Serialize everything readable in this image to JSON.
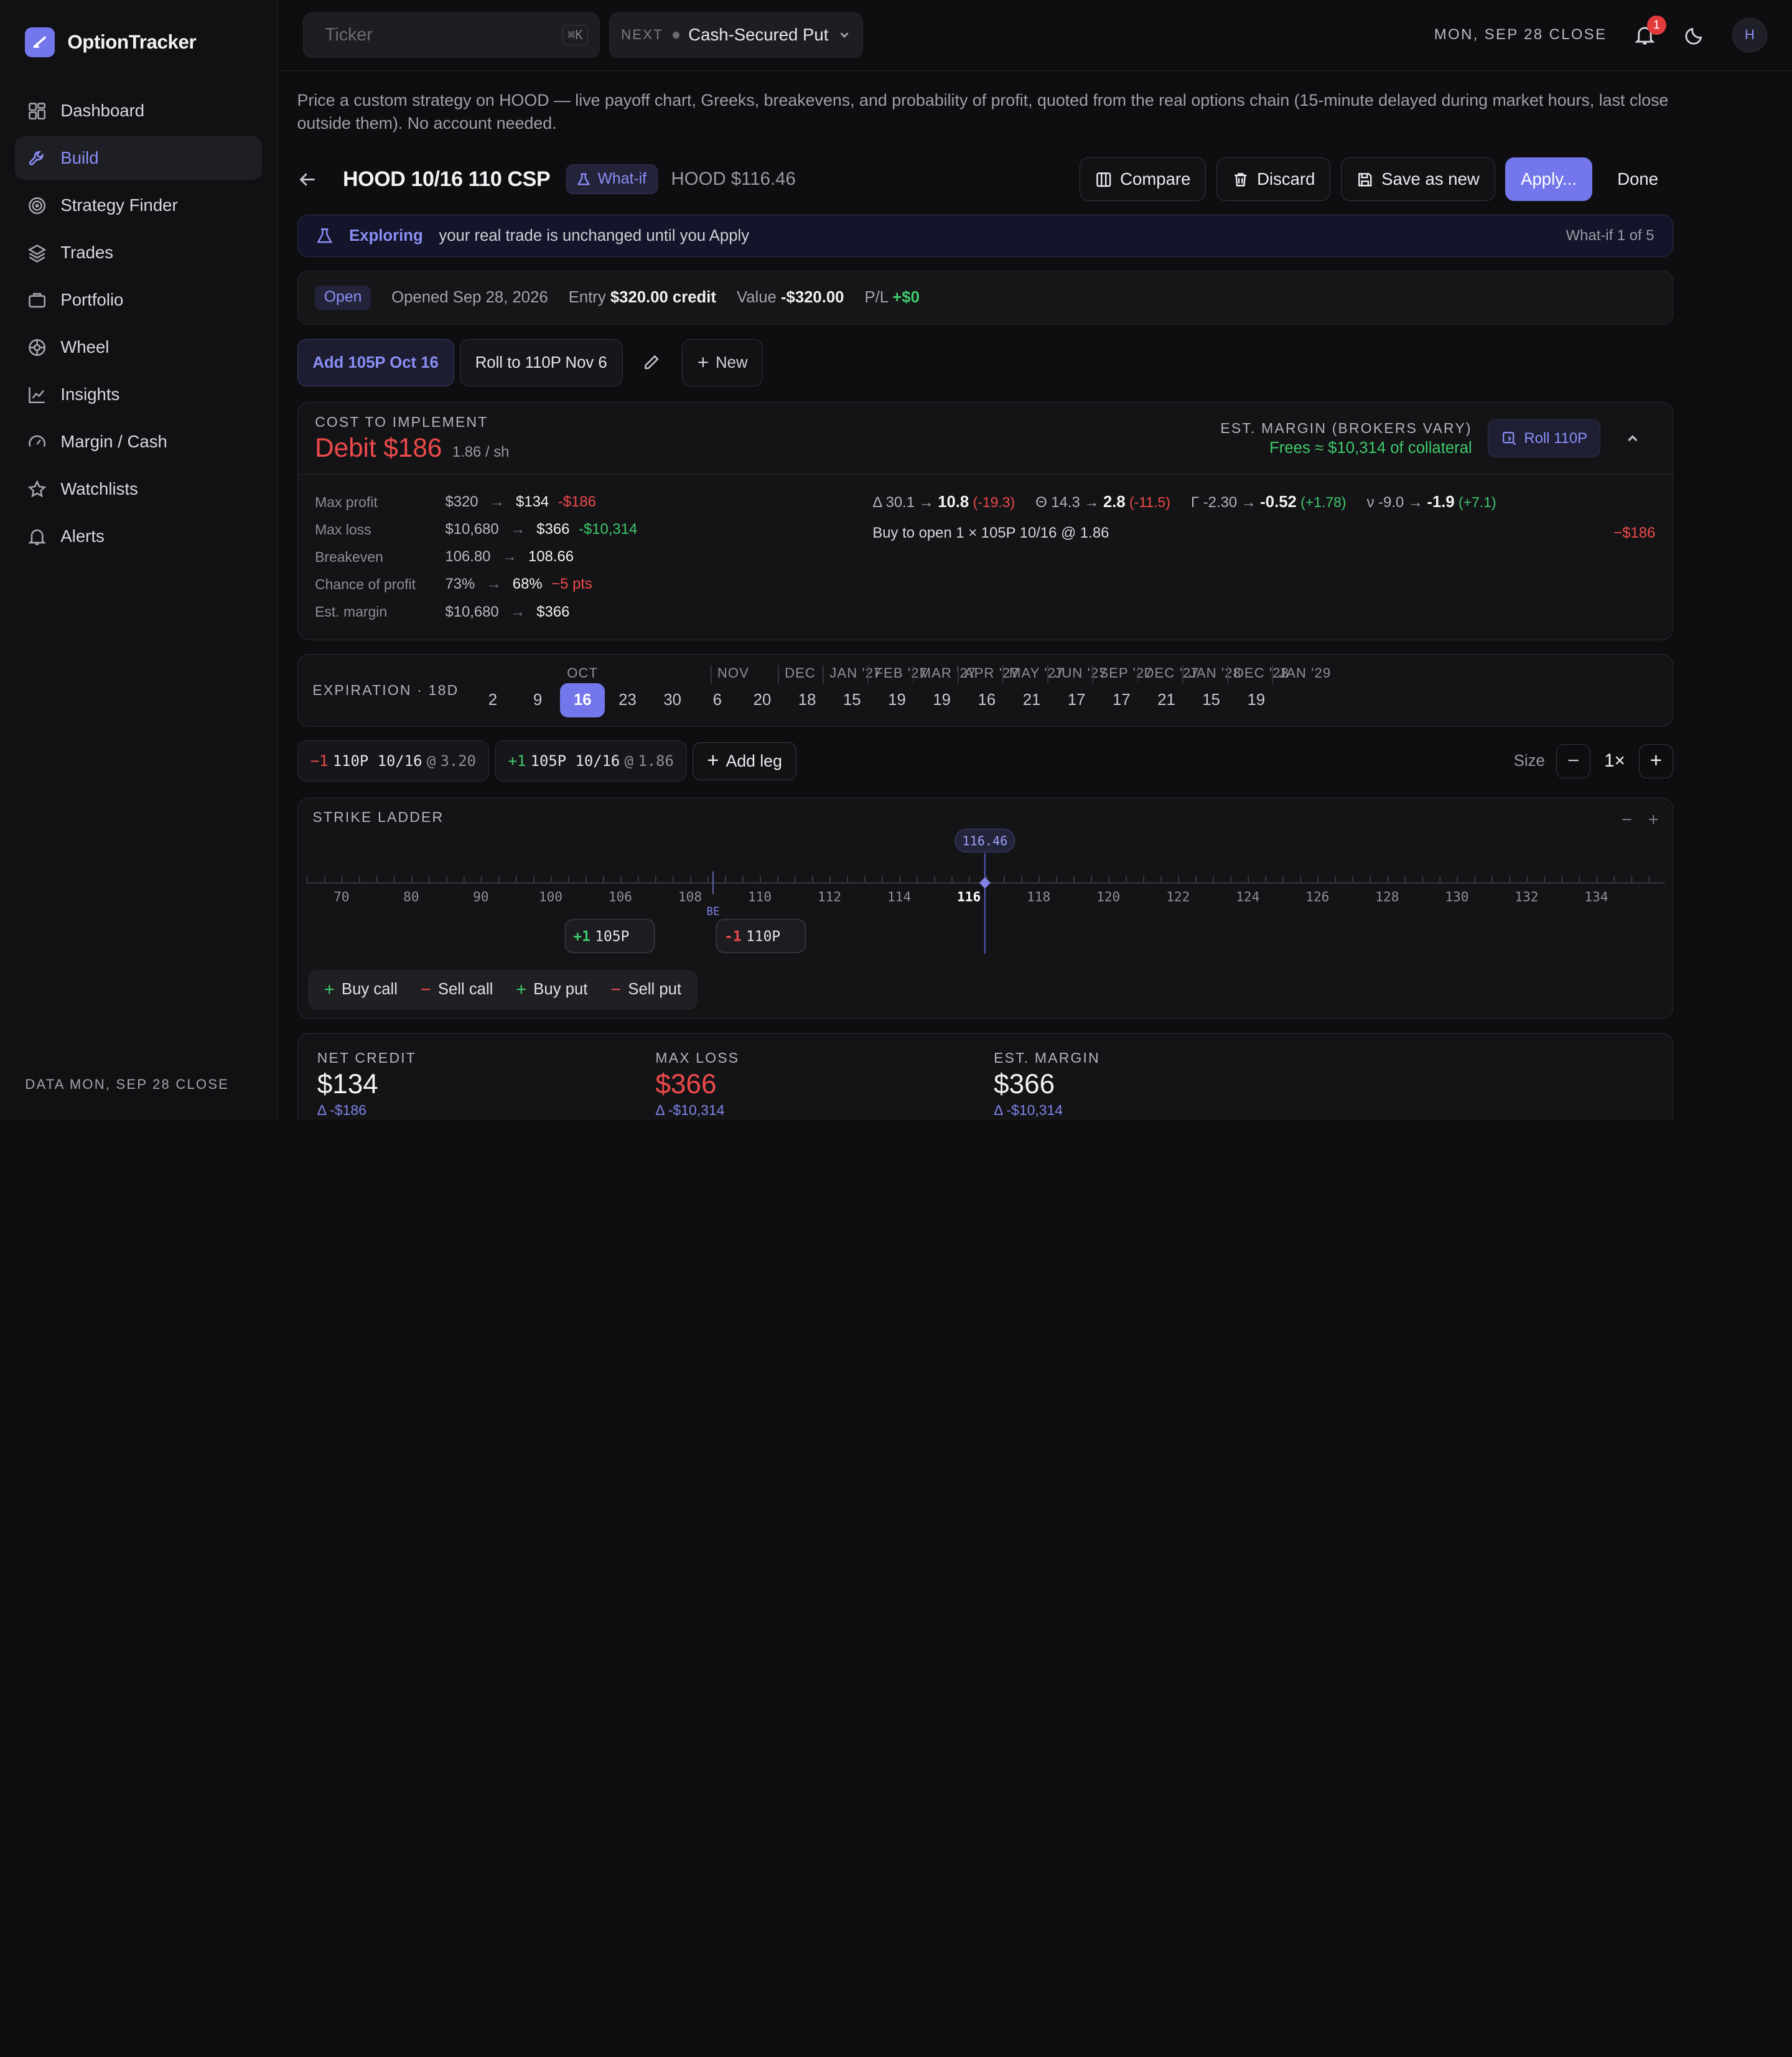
{
  "app": {
    "name": "OptionTracker"
  },
  "sidebar": {
    "items": [
      {
        "label": "Dashboard"
      },
      {
        "label": "Build"
      },
      {
        "label": "Strategy Finder"
      },
      {
        "label": "Trades"
      },
      {
        "label": "Portfolio"
      },
      {
        "label": "Wheel"
      },
      {
        "label": "Insights"
      },
      {
        "label": "Margin / Cash"
      },
      {
        "label": "Watchlists"
      },
      {
        "label": "Alerts"
      }
    ],
    "footer": "DATA MON, SEP 28 CLOSE"
  },
  "topbar": {
    "search_placeholder": "Ticker",
    "search_shortcut": "⌘K",
    "next_tag": "NEXT",
    "next_value": "Cash-Secured Put",
    "close_label": "MON, SEP 28 CLOSE",
    "notif_count": "1",
    "avatar": "H"
  },
  "intro": "Price a custom strategy on HOOD — live payoff chart, Greeks, breakevens, and probability of profit, quoted from the real options chain (15-minute delayed during market hours, last close outside them). No account needed.",
  "header": {
    "title": "HOOD 10/16 110 CSP",
    "whatif": "What-if",
    "price": "HOOD $116.46",
    "compare": "Compare",
    "discard": "Discard",
    "save_new": "Save as new",
    "apply": "Apply...",
    "done": "Done"
  },
  "explore": {
    "label": "Exploring",
    "text": "your real trade is unchanged until you Apply",
    "counter": "What-if 1 of 5"
  },
  "status": {
    "pill": "Open",
    "opened": "Opened Sep 28, 2026",
    "entry_lbl": "Entry",
    "entry_val": "$320.00 credit",
    "value_lbl": "Value",
    "value_val": "-$320.00",
    "pl_lbl": "P/L",
    "pl_val": "+$0"
  },
  "scenarios": {
    "tab1": "Add 105P Oct 16",
    "tab2": "Roll to 110P Nov 6",
    "new": "New"
  },
  "cost": {
    "eyebrow": "COST TO IMPLEMENT",
    "amount": "Debit $186",
    "per": "1.86 / sh",
    "margin_eyebrow": "EST. MARGIN (BROKERS VARY)",
    "frees": "Frees ≈ $10,314 of collateral",
    "roll": "Roll 110P",
    "metrics": [
      {
        "label": "Max profit",
        "from": "$320",
        "to": "$134",
        "delta": "-$186",
        "tone": "neg"
      },
      {
        "label": "Max loss",
        "from": "$10,680",
        "to": "$366",
        "delta": "-$10,314",
        "tone": "pos"
      },
      {
        "label": "Breakeven",
        "from": "106.80",
        "to": "108.66",
        "delta": "",
        "tone": ""
      },
      {
        "label": "Chance of profit",
        "from": "73%",
        "to": "68%",
        "delta": "−5 pts",
        "tone": "neg"
      },
      {
        "label": "Est. margin",
        "from": "$10,680",
        "to": "$366",
        "delta": "",
        "tone": ""
      }
    ],
    "greeks": [
      {
        "sym": "Δ",
        "from": "30.1",
        "to": "10.8",
        "delta": "(-19.3)",
        "tone": "neg"
      },
      {
        "sym": "Θ",
        "from": "14.3",
        "to": "2.8",
        "delta": "(-11.5)",
        "tone": "neg"
      },
      {
        "sym": "Γ",
        "from": "-2.30",
        "to": "-0.52",
        "delta": "(+1.78)",
        "tone": "pos"
      },
      {
        "sym": "ν",
        "from": "-9.0",
        "to": "-1.9",
        "delta": "(+7.1)",
        "tone": "pos"
      }
    ],
    "order_text": "Buy to open 1 × 105P 10/16 @ 1.86",
    "order_amt": "−$186"
  },
  "expiration": {
    "label": "EXPIRATION · 18D",
    "days": [
      "2",
      "9",
      "16",
      "23",
      "30",
      "6",
      "20",
      "18",
      "15",
      "19",
      "19",
      "16",
      "21",
      "17",
      "17",
      "21",
      "15",
      "19"
    ],
    "selected_index": 2,
    "months": [
      {
        "label": "OCT",
        "idx": 2.0,
        "sep": false
      },
      {
        "label": "NOV",
        "idx": 5.5,
        "sep": true
      },
      {
        "label": "DEC",
        "idx": 7.0,
        "sep": true
      },
      {
        "label": "JAN '27",
        "idx": 8.0,
        "sep": true
      },
      {
        "label": "FEB '27",
        "idx": 9.0,
        "sep": true
      },
      {
        "label": "MAR '27",
        "idx": 10.0,
        "sep": true
      },
      {
        "label": "APR '27",
        "idx": 11.0,
        "sep": true
      },
      {
        "label": "MAY '27",
        "idx": 12.0,
        "sep": true
      },
      {
        "label": "JUN '27",
        "idx": 13.0,
        "sep": true
      },
      {
        "label": "SEP '27",
        "idx": 14.0,
        "sep": true
      },
      {
        "label": "DEC '27",
        "idx": 15.0,
        "sep": true
      },
      {
        "label": "JAN '28",
        "idx": 16.0,
        "sep": true
      },
      {
        "label": "DEC '28",
        "idx": 17.0,
        "sep": true
      },
      {
        "label": "JAN '29",
        "idx": 18.0,
        "sep": true
      }
    ]
  },
  "legs": [
    {
      "qty": "−1",
      "qty_tone": "neg",
      "desc": "110P 10/16",
      "at": "@",
      "price": "3.20"
    },
    {
      "qty": "+1",
      "qty_tone": "pos",
      "desc": "105P 10/16",
      "at": "@",
      "price": "1.86"
    }
  ],
  "add_leg": "Add leg",
  "size": {
    "label": "Size",
    "value": "1×"
  },
  "ladder": {
    "title": "STRIKE LADDER",
    "spot_label": "116.46",
    "spot_value": 116.46,
    "be_label": "BE",
    "be_value": 108.66,
    "strikes": [
      "70",
      "80",
      "90",
      "100",
      "106",
      "108",
      "110",
      "112",
      "114",
      "116",
      "118",
      "120",
      "122",
      "124",
      "126",
      "128",
      "130",
      "132",
      "134"
    ],
    "current_strike": "116",
    "leg_markers": [
      {
        "qty": "+1",
        "tone": "pos",
        "label": "105P",
        "strike": 105
      },
      {
        "qty": "-1",
        "tone": "neg",
        "label": "110P",
        "strike": 110
      }
    ],
    "quick": [
      {
        "sign": "+",
        "label": "Buy call"
      },
      {
        "sign": "−",
        "label": "Sell call"
      },
      {
        "sign": "+",
        "label": "Buy put"
      },
      {
        "sign": "−",
        "label": "Sell put"
      }
    ]
  },
  "stats": [
    {
      "eyebrow": "NET CREDIT",
      "value": "$134",
      "delta": "Δ -$186",
      "tone": ""
    },
    {
      "eyebrow": "MAX LOSS",
      "value": "$366",
      "delta": "Δ -$10,314",
      "tone": "red"
    },
    {
      "eyebrow": "EST. MARGIN",
      "value": "$366",
      "delta": "Δ -$10,314",
      "tone": ""
    }
  ],
  "colors": {
    "accent": "#7477ec",
    "negative": "#ee4a4a",
    "positive": "#3fc86b",
    "background": "#0e0e11"
  }
}
